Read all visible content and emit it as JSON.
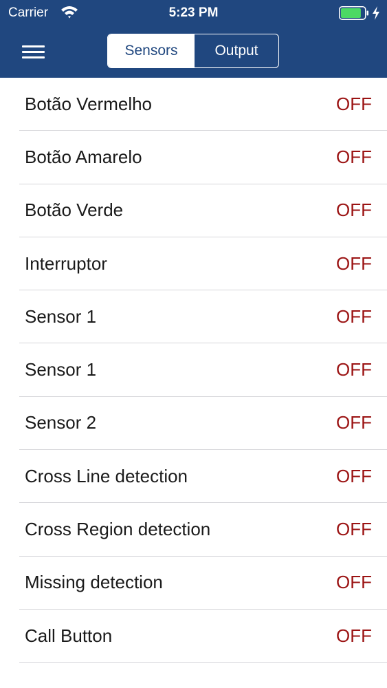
{
  "colors": {
    "header_bg": "#20477f",
    "off_value": "#9b1313",
    "separator": "#d5d5d9",
    "battery_fill": "#4cd964"
  },
  "status_bar": {
    "carrier": "Carrier",
    "time": "5:23 PM",
    "wifi_icon": "wifi-icon",
    "battery_icon": "battery-charging-icon",
    "battery_level": 0.85
  },
  "nav": {
    "menu_icon": "hamburger-menu-icon",
    "segments": [
      {
        "label": "Sensors",
        "selected": true
      },
      {
        "label": "Output",
        "selected": false
      }
    ]
  },
  "sensors": [
    {
      "label": "Botão Vermelho",
      "value": "OFF"
    },
    {
      "label": "Botão Amarelo",
      "value": "OFF"
    },
    {
      "label": "Botão Verde",
      "value": "OFF"
    },
    {
      "label": "Interruptor",
      "value": "OFF"
    },
    {
      "label": "Sensor 1",
      "value": "OFF"
    },
    {
      "label": "Sensor 1",
      "value": "OFF"
    },
    {
      "label": "Sensor 2",
      "value": "OFF"
    },
    {
      "label": "Cross Line detection",
      "value": "OFF"
    },
    {
      "label": "Cross Region detection",
      "value": "OFF"
    },
    {
      "label": "Missing detection",
      "value": "OFF"
    },
    {
      "label": "Call Button",
      "value": "OFF"
    }
  ]
}
